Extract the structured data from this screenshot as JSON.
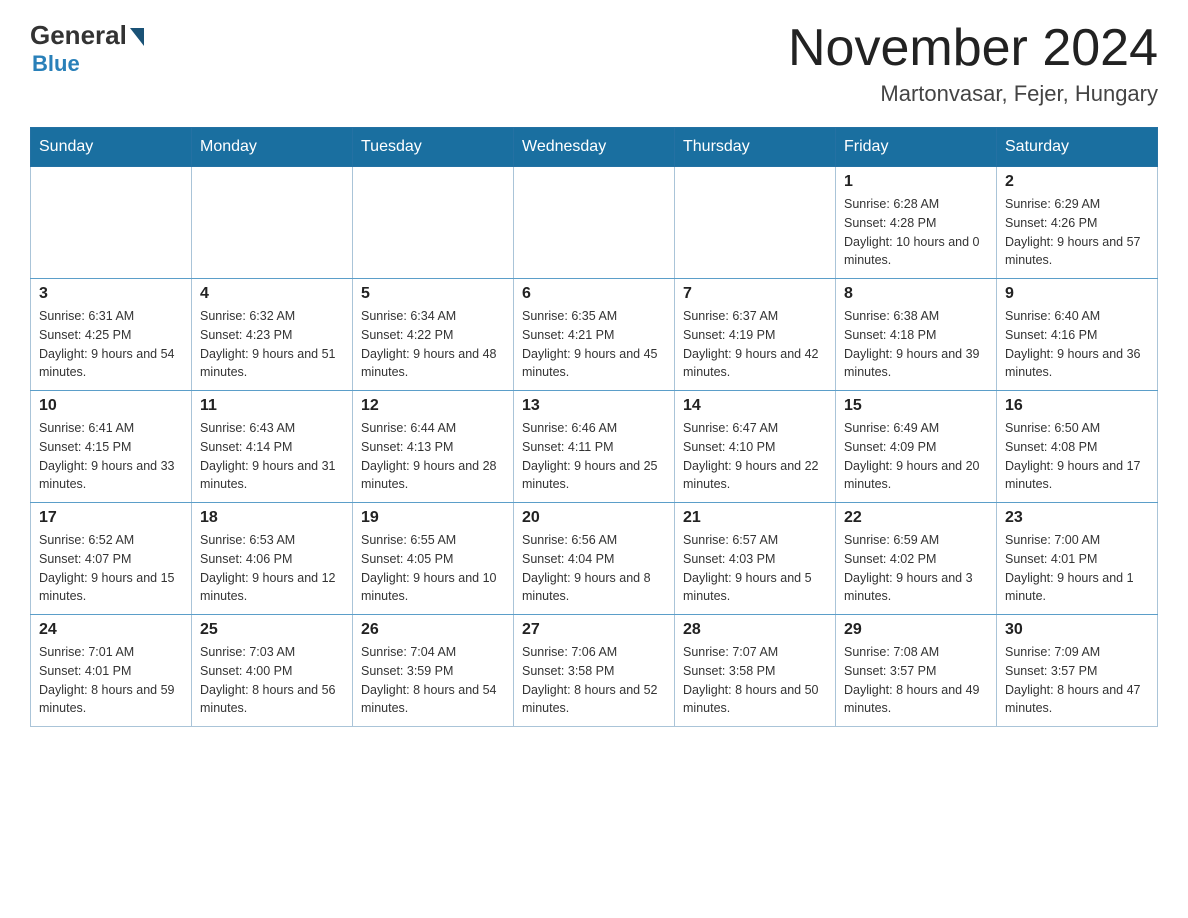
{
  "header": {
    "logo_text_general": "General",
    "logo_text_blue": "Blue",
    "month_title": "November 2024",
    "location": "Martonvasar, Fejer, Hungary"
  },
  "days_of_week": [
    "Sunday",
    "Monday",
    "Tuesday",
    "Wednesday",
    "Thursday",
    "Friday",
    "Saturday"
  ],
  "weeks": [
    [
      {
        "day": "",
        "info": ""
      },
      {
        "day": "",
        "info": ""
      },
      {
        "day": "",
        "info": ""
      },
      {
        "day": "",
        "info": ""
      },
      {
        "day": "",
        "info": ""
      },
      {
        "day": "1",
        "info": "Sunrise: 6:28 AM\nSunset: 4:28 PM\nDaylight: 10 hours and 0 minutes."
      },
      {
        "day": "2",
        "info": "Sunrise: 6:29 AM\nSunset: 4:26 PM\nDaylight: 9 hours and 57 minutes."
      }
    ],
    [
      {
        "day": "3",
        "info": "Sunrise: 6:31 AM\nSunset: 4:25 PM\nDaylight: 9 hours and 54 minutes."
      },
      {
        "day": "4",
        "info": "Sunrise: 6:32 AM\nSunset: 4:23 PM\nDaylight: 9 hours and 51 minutes."
      },
      {
        "day": "5",
        "info": "Sunrise: 6:34 AM\nSunset: 4:22 PM\nDaylight: 9 hours and 48 minutes."
      },
      {
        "day": "6",
        "info": "Sunrise: 6:35 AM\nSunset: 4:21 PM\nDaylight: 9 hours and 45 minutes."
      },
      {
        "day": "7",
        "info": "Sunrise: 6:37 AM\nSunset: 4:19 PM\nDaylight: 9 hours and 42 minutes."
      },
      {
        "day": "8",
        "info": "Sunrise: 6:38 AM\nSunset: 4:18 PM\nDaylight: 9 hours and 39 minutes."
      },
      {
        "day": "9",
        "info": "Sunrise: 6:40 AM\nSunset: 4:16 PM\nDaylight: 9 hours and 36 minutes."
      }
    ],
    [
      {
        "day": "10",
        "info": "Sunrise: 6:41 AM\nSunset: 4:15 PM\nDaylight: 9 hours and 33 minutes."
      },
      {
        "day": "11",
        "info": "Sunrise: 6:43 AM\nSunset: 4:14 PM\nDaylight: 9 hours and 31 minutes."
      },
      {
        "day": "12",
        "info": "Sunrise: 6:44 AM\nSunset: 4:13 PM\nDaylight: 9 hours and 28 minutes."
      },
      {
        "day": "13",
        "info": "Sunrise: 6:46 AM\nSunset: 4:11 PM\nDaylight: 9 hours and 25 minutes."
      },
      {
        "day": "14",
        "info": "Sunrise: 6:47 AM\nSunset: 4:10 PM\nDaylight: 9 hours and 22 minutes."
      },
      {
        "day": "15",
        "info": "Sunrise: 6:49 AM\nSunset: 4:09 PM\nDaylight: 9 hours and 20 minutes."
      },
      {
        "day": "16",
        "info": "Sunrise: 6:50 AM\nSunset: 4:08 PM\nDaylight: 9 hours and 17 minutes."
      }
    ],
    [
      {
        "day": "17",
        "info": "Sunrise: 6:52 AM\nSunset: 4:07 PM\nDaylight: 9 hours and 15 minutes."
      },
      {
        "day": "18",
        "info": "Sunrise: 6:53 AM\nSunset: 4:06 PM\nDaylight: 9 hours and 12 minutes."
      },
      {
        "day": "19",
        "info": "Sunrise: 6:55 AM\nSunset: 4:05 PM\nDaylight: 9 hours and 10 minutes."
      },
      {
        "day": "20",
        "info": "Sunrise: 6:56 AM\nSunset: 4:04 PM\nDaylight: 9 hours and 8 minutes."
      },
      {
        "day": "21",
        "info": "Sunrise: 6:57 AM\nSunset: 4:03 PM\nDaylight: 9 hours and 5 minutes."
      },
      {
        "day": "22",
        "info": "Sunrise: 6:59 AM\nSunset: 4:02 PM\nDaylight: 9 hours and 3 minutes."
      },
      {
        "day": "23",
        "info": "Sunrise: 7:00 AM\nSunset: 4:01 PM\nDaylight: 9 hours and 1 minute."
      }
    ],
    [
      {
        "day": "24",
        "info": "Sunrise: 7:01 AM\nSunset: 4:01 PM\nDaylight: 8 hours and 59 minutes."
      },
      {
        "day": "25",
        "info": "Sunrise: 7:03 AM\nSunset: 4:00 PM\nDaylight: 8 hours and 56 minutes."
      },
      {
        "day": "26",
        "info": "Sunrise: 7:04 AM\nSunset: 3:59 PM\nDaylight: 8 hours and 54 minutes."
      },
      {
        "day": "27",
        "info": "Sunrise: 7:06 AM\nSunset: 3:58 PM\nDaylight: 8 hours and 52 minutes."
      },
      {
        "day": "28",
        "info": "Sunrise: 7:07 AM\nSunset: 3:58 PM\nDaylight: 8 hours and 50 minutes."
      },
      {
        "day": "29",
        "info": "Sunrise: 7:08 AM\nSunset: 3:57 PM\nDaylight: 8 hours and 49 minutes."
      },
      {
        "day": "30",
        "info": "Sunrise: 7:09 AM\nSunset: 3:57 PM\nDaylight: 8 hours and 47 minutes."
      }
    ]
  ]
}
